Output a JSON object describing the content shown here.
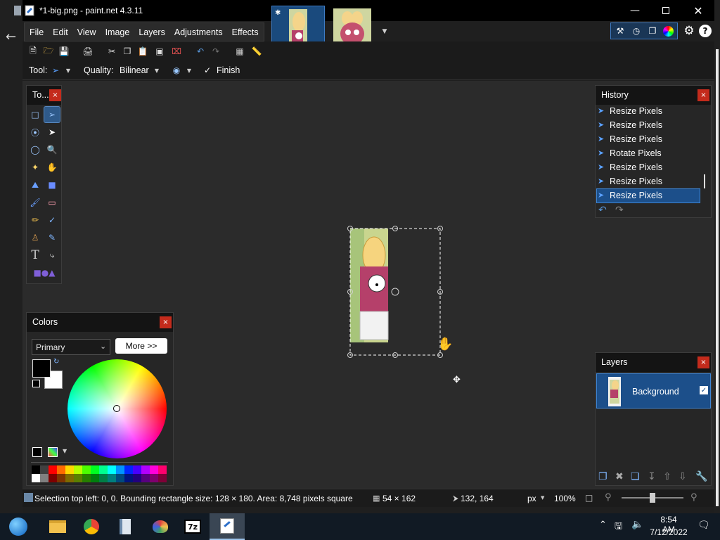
{
  "window": {
    "title": "*1-big.png - paint.net 4.3.11"
  },
  "menu": [
    "File",
    "Edit",
    "View",
    "Image",
    "Layers",
    "Adjustments",
    "Effects"
  ],
  "options_bar": {
    "tool_label": "Tool:",
    "quality_label": "Quality:",
    "quality_value": "Bilinear",
    "finish_label": "Finish"
  },
  "tools_panel": {
    "title": "To..."
  },
  "colors_panel": {
    "title": "Colors",
    "mode": "Primary",
    "more_button": "More >>",
    "primary_color": "#000000",
    "secondary_color": "#ffffff",
    "palette_row1": [
      "#000000",
      "#404040",
      "#ff0000",
      "#ff6a00",
      "#ffd800",
      "#b6ff00",
      "#4cff00",
      "#00ff21",
      "#00ff90",
      "#00ffff",
      "#0094ff",
      "#0026ff",
      "#4800ff",
      "#b200ff",
      "#ff00dc",
      "#ff006e"
    ],
    "palette_row2": [
      "#ffffff",
      "#808080",
      "#7f0000",
      "#7f3300",
      "#7f6a00",
      "#5b7f00",
      "#267f00",
      "#007f0e",
      "#007f46",
      "#007f7f",
      "#004a7f",
      "#00137f",
      "#21007f",
      "#57007f",
      "#7f006e",
      "#7f0037"
    ]
  },
  "history_panel": {
    "title": "History",
    "items": [
      "Resize Pixels",
      "Resize Pixels",
      "Resize Pixels",
      "Rotate Pixels",
      "Resize Pixels",
      "Resize Pixels",
      "Resize Pixels"
    ],
    "selected_index": 6
  },
  "layers_panel": {
    "title": "Layers",
    "layers": [
      {
        "name": "Background",
        "visible": true
      }
    ]
  },
  "statusbar": {
    "selection_info": "Selection top left: 0, 0. Bounding rectangle size: 128 × 180. Area: 8,748 pixels square",
    "size": "54 × 162",
    "cursor": "132, 164",
    "units": "px",
    "zoom": "100%"
  },
  "taskbar": {
    "time": "8:54 AM",
    "date": "7/12/2022",
    "zip_label": "7z"
  },
  "colors": {
    "accent": "#1c4f8a",
    "close_red": "#c42b1c",
    "canvas_bg": "#2b2b2b",
    "panel_bg": "#262626"
  }
}
